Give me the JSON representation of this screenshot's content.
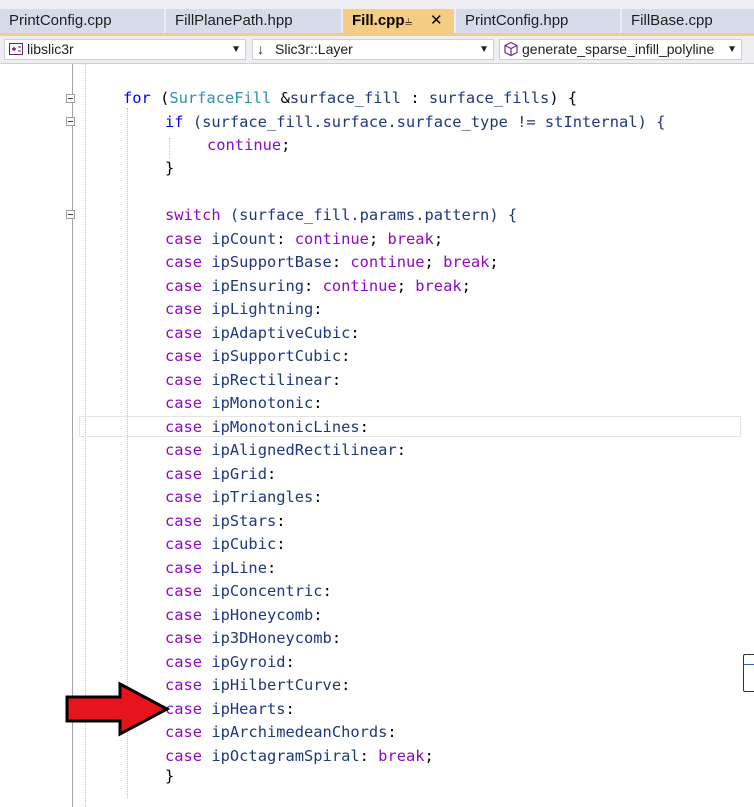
{
  "tabs": [
    {
      "label": "PrintConfig.cpp",
      "active": false
    },
    {
      "label": "FillPlanePath.hpp",
      "active": false
    },
    {
      "label": "Fill.cpp",
      "active": true
    },
    {
      "label": "PrintConfig.hpp",
      "active": false
    },
    {
      "label": "FillBase.cpp",
      "active": false
    }
  ],
  "tab_pin_icon": "pin-icon",
  "tab_close_icon": "close-icon",
  "nav": {
    "project": "libslic3r",
    "scope": "Slic3r::Layer",
    "member": "generate_sparse_infill_polyline"
  },
  "code": {
    "for_kw": "for",
    "for_open": " (",
    "for_type": "SurfaceFill",
    "for_amp": " &",
    "for_var": "surface_fill",
    "for_colon": " : ",
    "for_coll": "surface_fills",
    "for_close": ") {",
    "if_kw": "if",
    "if_expr": " (surface_fill.surface.surface_type != stInternal) {",
    "continue_kw": "continue",
    "semicolon": ";",
    "brace_close": "}",
    "switch_kw": "switch",
    "switch_expr": " (surface_fill.params.pattern) {",
    "case_kw": "case",
    "break_kw": "break",
    "cases": [
      {
        "name": "ipCount",
        "tail": ": continue; break;"
      },
      {
        "name": "ipSupportBase",
        "tail": ": continue; break;"
      },
      {
        "name": "ipEnsuring",
        "tail": ": continue; break;"
      },
      {
        "name": "ipLightning",
        "tail": ":"
      },
      {
        "name": "ipAdaptiveCubic",
        "tail": ":"
      },
      {
        "name": "ipSupportCubic",
        "tail": ":"
      },
      {
        "name": "ipRectilinear",
        "tail": ":"
      },
      {
        "name": "ipMonotonic",
        "tail": ":"
      },
      {
        "name": "ipMonotonicLines",
        "tail": ":"
      },
      {
        "name": "ipAlignedRectilinear",
        "tail": ":"
      },
      {
        "name": "ipGrid",
        "tail": ":"
      },
      {
        "name": "ipTriangles",
        "tail": ":"
      },
      {
        "name": "ipStars",
        "tail": ":"
      },
      {
        "name": "ipCubic",
        "tail": ":"
      },
      {
        "name": "ipLine",
        "tail": ":"
      },
      {
        "name": "ipConcentric",
        "tail": ":"
      },
      {
        "name": "ipHoneycomb",
        "tail": ":"
      },
      {
        "name": "ip3DHoneycomb",
        "tail": ":"
      },
      {
        "name": "ipGyroid",
        "tail": ":"
      },
      {
        "name": "ipHilbertCurve",
        "tail": ":"
      },
      {
        "name": "ipHearts",
        "tail": ":"
      },
      {
        "name": "ipArchimedeanChords",
        "tail": ":"
      },
      {
        "name": "ipOctagramSpiral",
        "tail": ": break;"
      }
    ]
  },
  "annotation_arrow_color": "#e8141b",
  "colors": {
    "keyword": "#8f08c4",
    "control": "#0000ff",
    "type": "#2b91af",
    "identifier": "#1f377f",
    "active_tab": "#f5cc84"
  }
}
